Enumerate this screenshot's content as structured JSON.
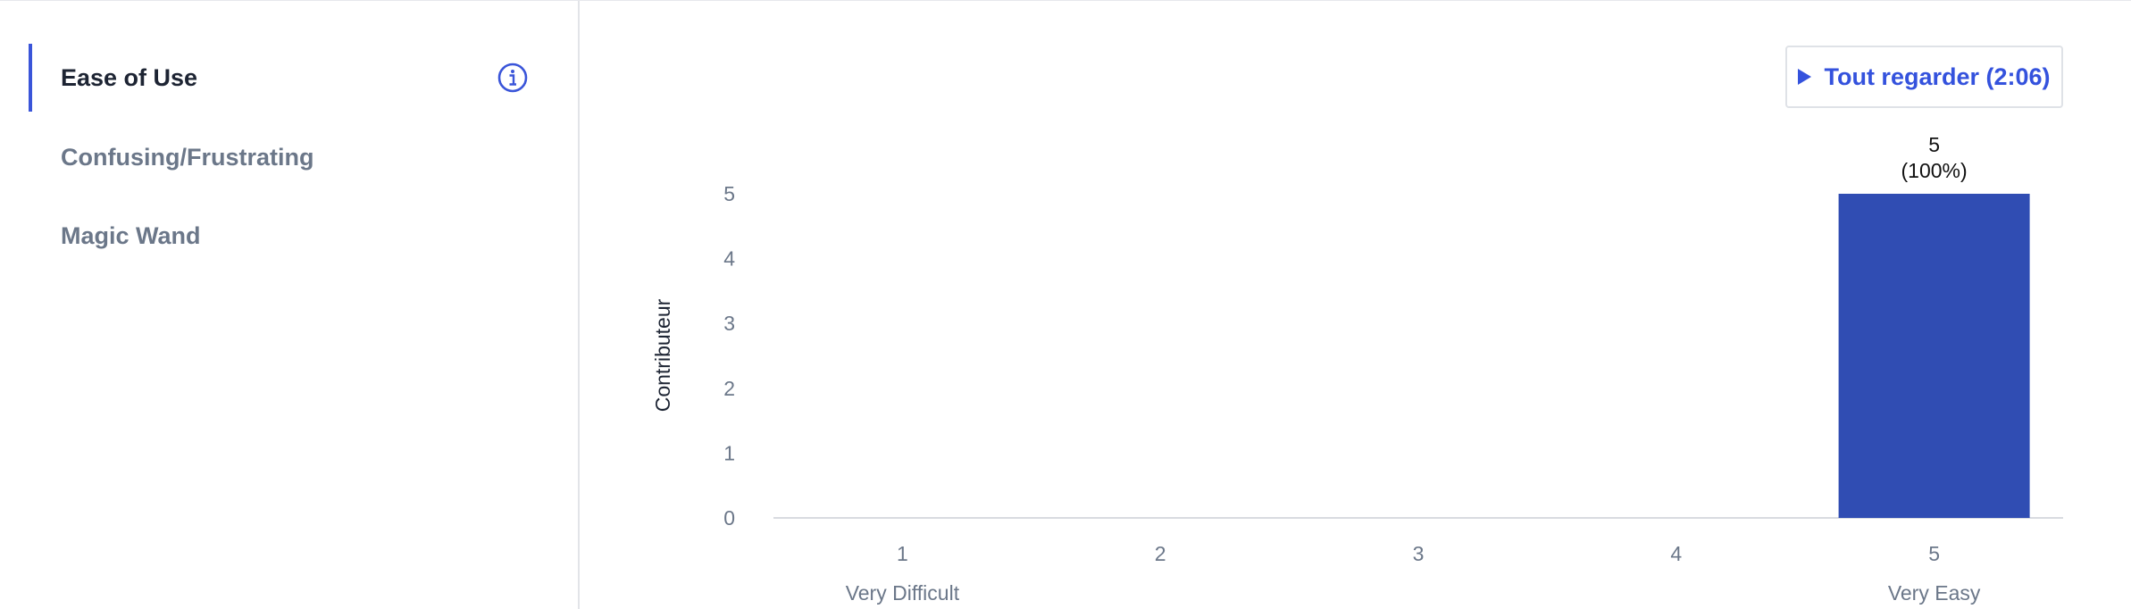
{
  "sidebar": {
    "items": [
      {
        "label": "Ease of Use",
        "active": true
      },
      {
        "label": "Confusing/Frustrating",
        "active": false
      },
      {
        "label": "Magic Wand",
        "active": false
      }
    ]
  },
  "toolbar": {
    "watch_label": "Tout regarder (2:06)"
  },
  "colors": {
    "accent": "#3452dd",
    "bar": "#304db3",
    "axis_text": "#6b7789"
  },
  "chart_data": {
    "type": "bar",
    "categories": [
      "1",
      "2",
      "3",
      "4",
      "5"
    ],
    "category_sublabels": [
      "Very Difficult",
      "",
      "",
      "",
      "Very Easy"
    ],
    "values": [
      0,
      0,
      0,
      0,
      5
    ],
    "data_labels": [
      {
        "index": 4,
        "value": "5",
        "percent": "(100%)"
      }
    ],
    "xlabel": "",
    "ylabel": "Contributeur",
    "ylim": [
      0,
      5
    ],
    "yticks": [
      0,
      1,
      2,
      3,
      4,
      5
    ],
    "grid": false
  }
}
